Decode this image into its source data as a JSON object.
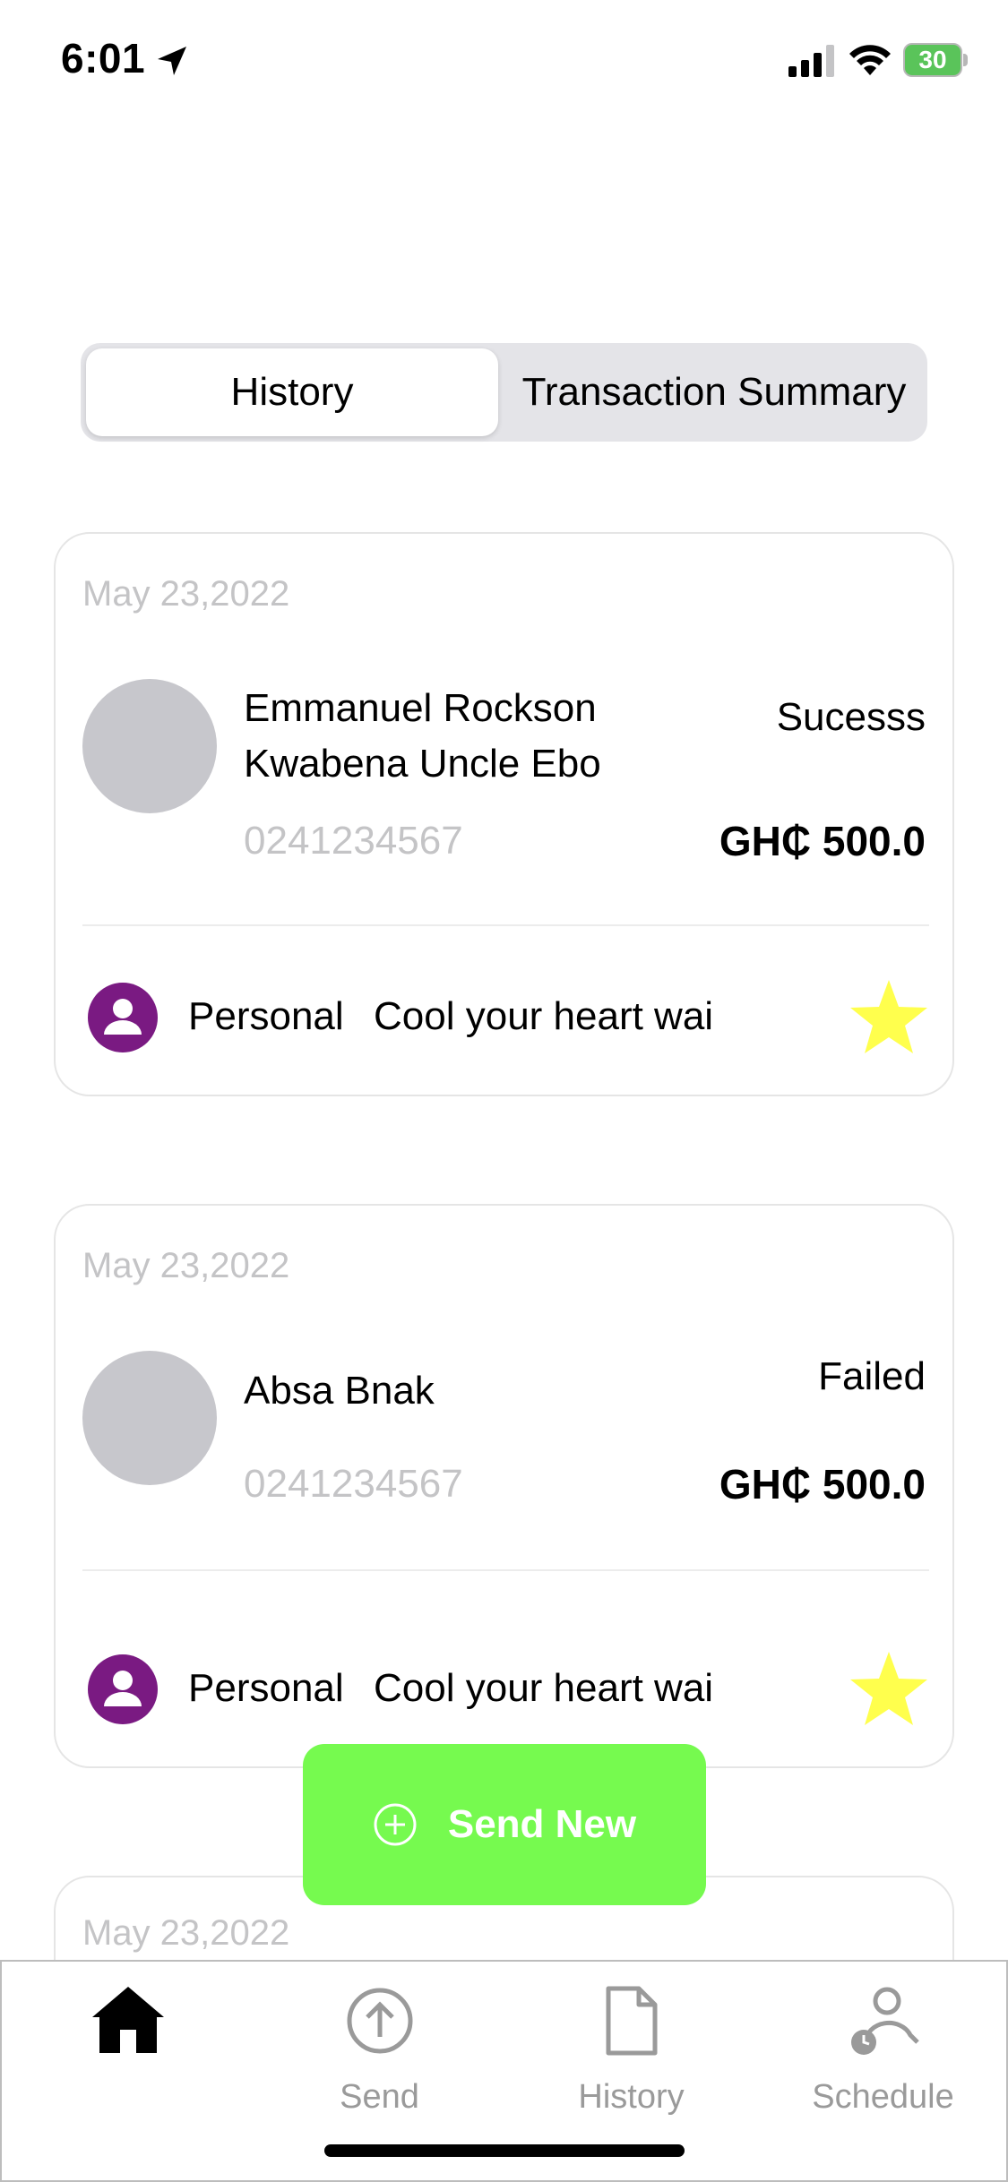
{
  "status_bar": {
    "time": "6:01",
    "battery": "30"
  },
  "segmented": {
    "history_label": "History",
    "summary_label": "Transaction Summary",
    "selected": "History"
  },
  "transactions": [
    {
      "date": "May 23,2022",
      "name_line1": "Emmanuel Rockson",
      "name_line2": "Kwabena Uncle Ebo",
      "phone": "0241234567",
      "status": "Sucesss",
      "amount": "GH₵ 500.0",
      "category": "Personal",
      "note": "Cool your heart wai"
    },
    {
      "date": "May 23,2022",
      "name_line1": "Absa Bnak",
      "phone": "0241234567",
      "status": "Failed",
      "amount": "GH₵ 500.0",
      "category": "Personal",
      "note": "Cool your heart wai"
    },
    {
      "date": "May 23,2022"
    }
  ],
  "send_new_label": "Send New",
  "tab_bar": {
    "home_label": "",
    "send_label": "Send",
    "history_label": "History",
    "schedule_label": "Schedule"
  },
  "colors": {
    "accent_green": "#76fa4f",
    "category_purple": "#7a1a82",
    "star_yellow": "#ffff4d",
    "avatar_gray": "#c7c7cc",
    "muted_text": "#c4c4c6"
  },
  "icons": {
    "location": "location-arrow-icon",
    "signal": "signal-icon",
    "wifi": "wifi-icon",
    "battery": "battery-icon",
    "person": "person-icon",
    "star": "star-icon",
    "plus": "plus-circle-icon",
    "home": "home-icon",
    "send": "upload-circle-icon",
    "history": "document-icon",
    "schedule": "person-clock-icon"
  }
}
